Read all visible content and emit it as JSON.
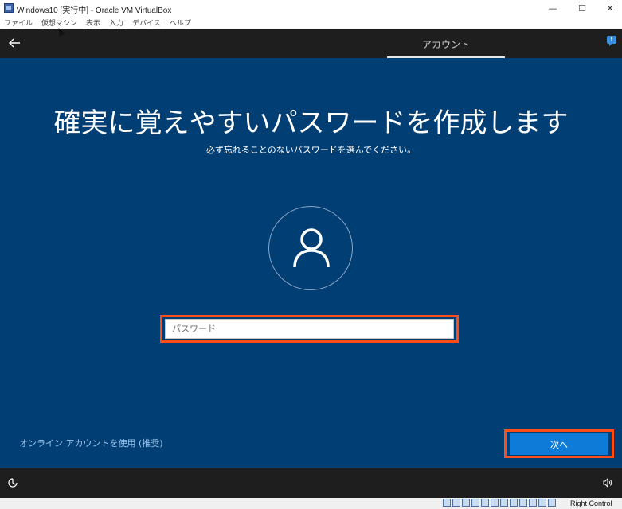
{
  "window": {
    "title": "Windows10 [実行中] - Oracle VM VirtualBox",
    "minimize": "—",
    "maximize": "☐",
    "close": "✕"
  },
  "menu": {
    "items": [
      "ファイル",
      "仮想マシン",
      "表示",
      "入力",
      "デバイス",
      "ヘルプ"
    ]
  },
  "vm": {
    "tab_label": "アカウント",
    "heading": "確実に覚えやすいパスワードを作成します",
    "subheading": "必ず忘れることのないパスワードを選んでください。",
    "password_placeholder": "パスワード",
    "password_value": "",
    "online_account_link": "オンライン アカウントを使用 (推奨)",
    "next_button": "次へ",
    "background_color": "#003e74",
    "accent_color": "#0f7bd8",
    "highlight_color": "#ff4d1a"
  },
  "status_bar": {
    "host_key": "Right Control"
  }
}
